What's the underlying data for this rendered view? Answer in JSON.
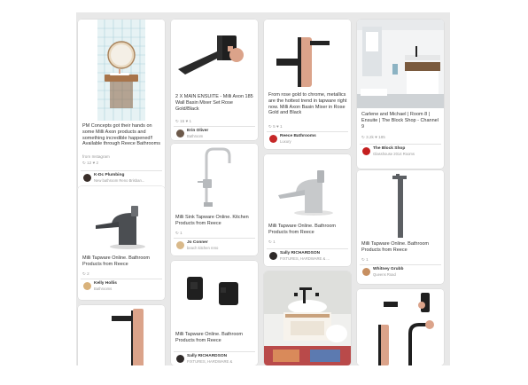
{
  "pins": {
    "p1": {
      "desc": "PM Concepts got their hands on some Milli Axon products and something incredible happened!! Available through Reece Bathrooms",
      "source": "from Instagram",
      "meta": "↻ 12   ♥ 2",
      "user": "K-Dc Plumbing",
      "board": "New bathroom Reno Brisban..."
    },
    "p2": {
      "desc": "Milli Tapware Online. Bathroom Products from Reece",
      "meta": "↻ 2",
      "user": "Kelly Hollis",
      "board": "Bathrooms"
    },
    "p3": {
      "desc": "2 X MAIN ENSUITE - Milli Axon 185 Wall Basin Mixer Set Rose Gold/Black",
      "meta": "↻ 15   ♥ 1",
      "user": "Erin Oliver",
      "board": "Bathroom"
    },
    "p4": {
      "desc": "Milli Sink Tapware Online. Kitchen Products from Reece",
      "meta": "↻ 1",
      "user": "Jo Conner",
      "board": "beach kitchen reno"
    },
    "p5": {
      "desc": "Milli Tapware Online. Bathroom Products from Reece",
      "user": "Sally RICHARDSON",
      "board": "FIXTURES, HARDWARE &"
    },
    "p6": {
      "desc": "From rose gold to chrome, metallics are the hottest trend in tapware right now. Milli Axon Basin Mixer in Rose Gold and Black",
      "meta": "↻ 5   ♥ 1",
      "user": "Reece Bathrooms",
      "board": "Luxury"
    },
    "p7": {
      "desc": "Milli Tapware Online. Bathroom Products from Reece",
      "meta": "↻ 1",
      "user": "Sally RICHARDSON",
      "board": "FIXTURES, HARDWARE & ..."
    },
    "p8": {
      "desc": "Carlene and Michael | Room 8 | Ensuite | The Block Shop - Channel 9",
      "meta": "↻ 3.2k   ♥ 185",
      "user": "The Block Shop",
      "board": "Glasshouse 2014 Rooms"
    },
    "p9": {
      "desc": "Milli Tapware Online. Bathroom Products from Reece",
      "meta": "↻ 1",
      "user": "Whitney Grubb",
      "board": "Queens Road"
    }
  },
  "colors": {
    "rose_gold": "#dba38a",
    "black_metal": "#232323",
    "chrome": "#c4c6c8",
    "gunmetal": "#5c5f63",
    "tile": "#d6ecf2"
  },
  "icons": [
    "faucet",
    "wall-mixer",
    "avatar"
  ]
}
